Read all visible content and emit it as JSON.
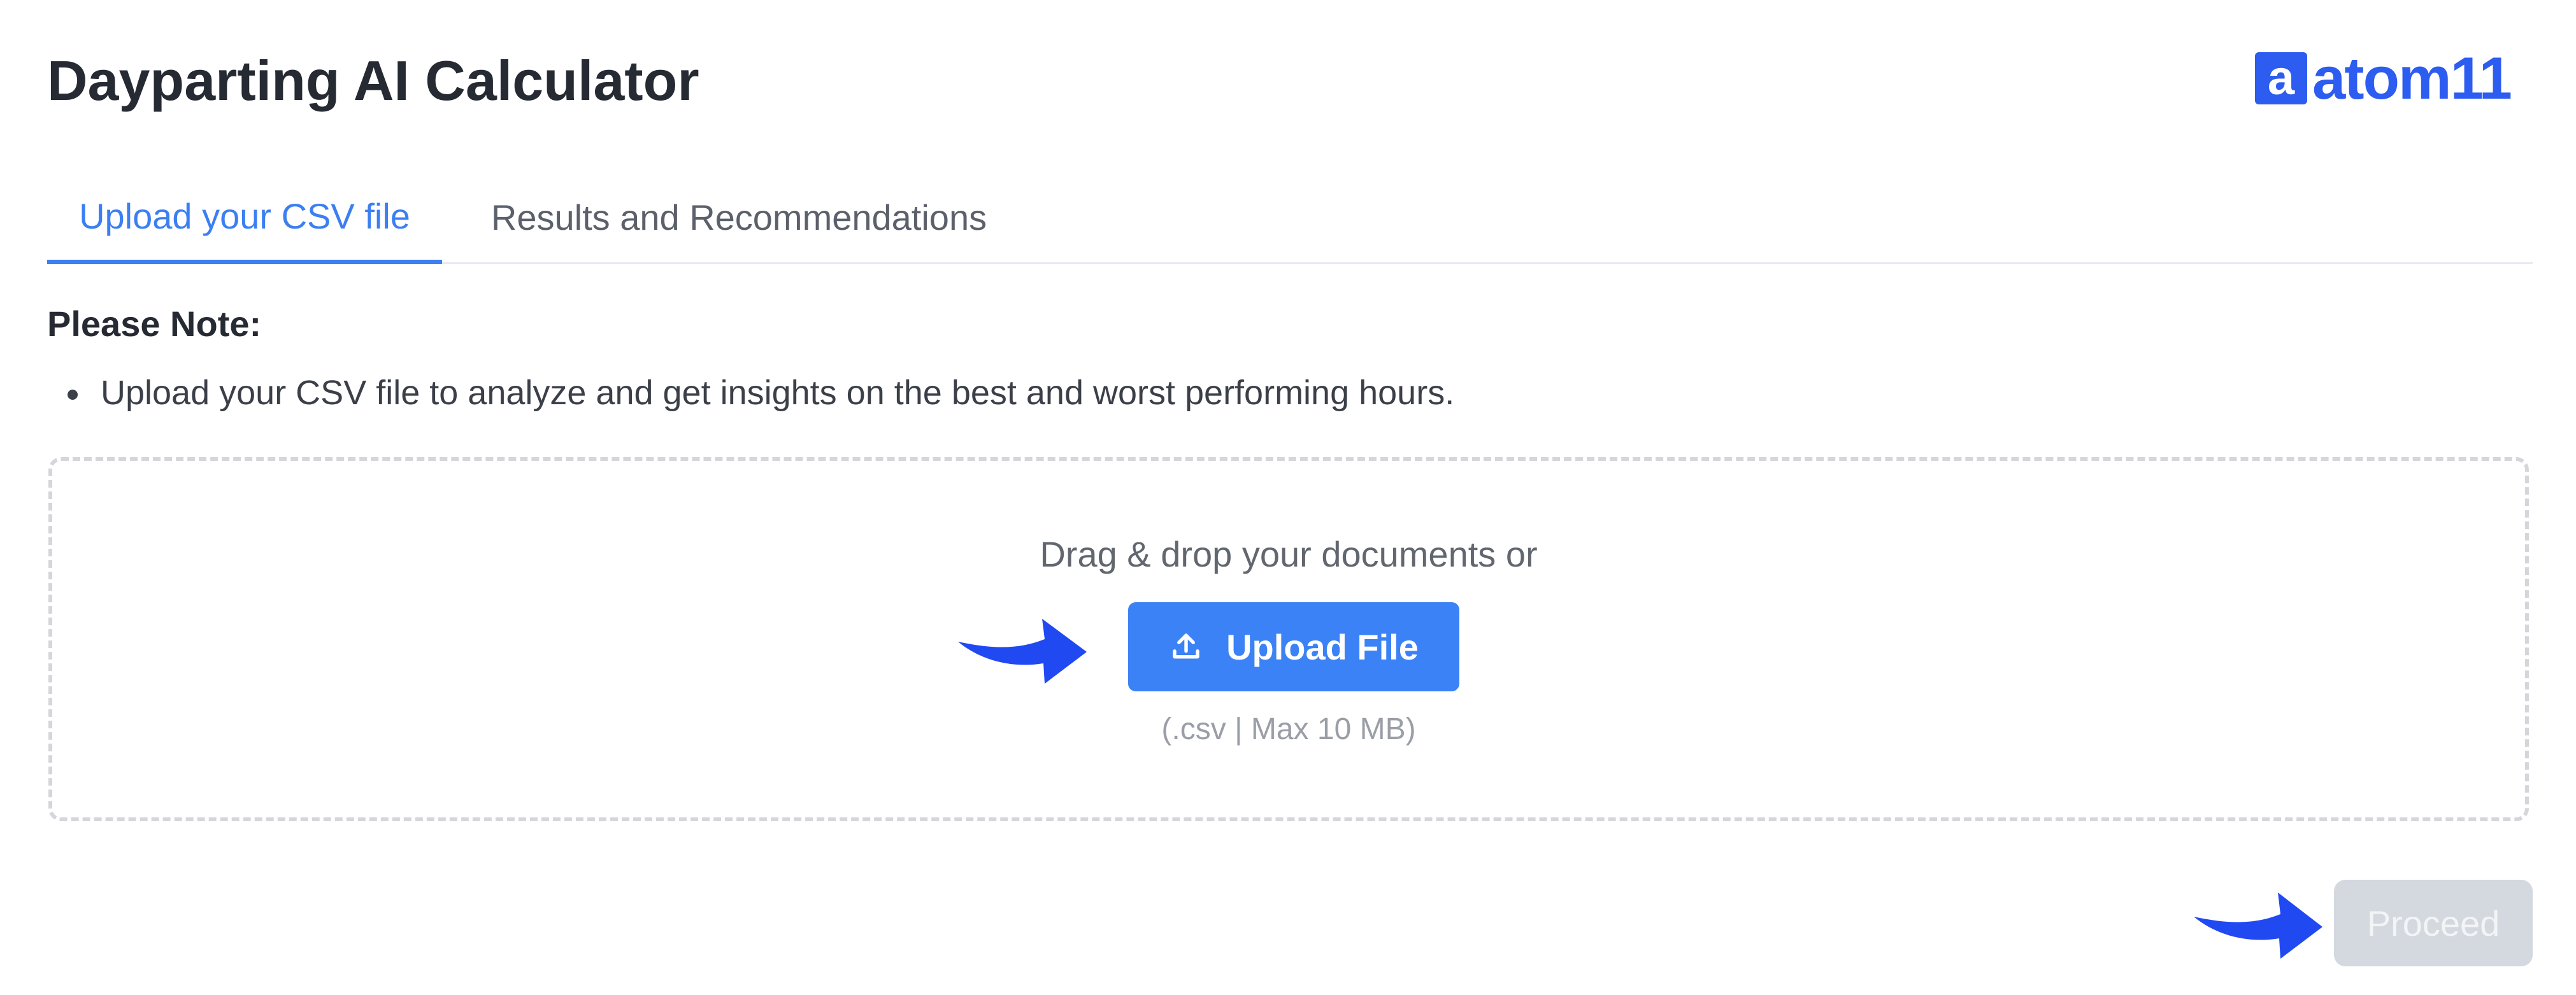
{
  "header": {
    "title": "Dayparting AI Calculator",
    "logo_text": "atom11",
    "logo_mark_letter": "a",
    "brand_color": "#2d5cf0"
  },
  "tabs": [
    {
      "label": "Upload your CSV file",
      "active": true
    },
    {
      "label": "Results and Recommendations",
      "active": false
    }
  ],
  "note": {
    "heading": "Please Note:",
    "items": [
      "Upload your CSV file to analyze and get insights on the best and worst performing hours."
    ]
  },
  "dropzone": {
    "prompt": "Drag & drop your documents or",
    "upload_button_label": "Upload File",
    "upload_icon": "upload-icon",
    "file_hint": "(.csv | Max 10 MB)"
  },
  "footer": {
    "proceed_label": "Proceed",
    "proceed_enabled": false
  },
  "annotations": {
    "arrow_icon": "arrow-right-icon",
    "arrow_color": "#2149f2"
  },
  "colors": {
    "accent": "#3b82f6",
    "active_tab": "#3b7ff2",
    "disabled_button": "#d4d8df"
  }
}
